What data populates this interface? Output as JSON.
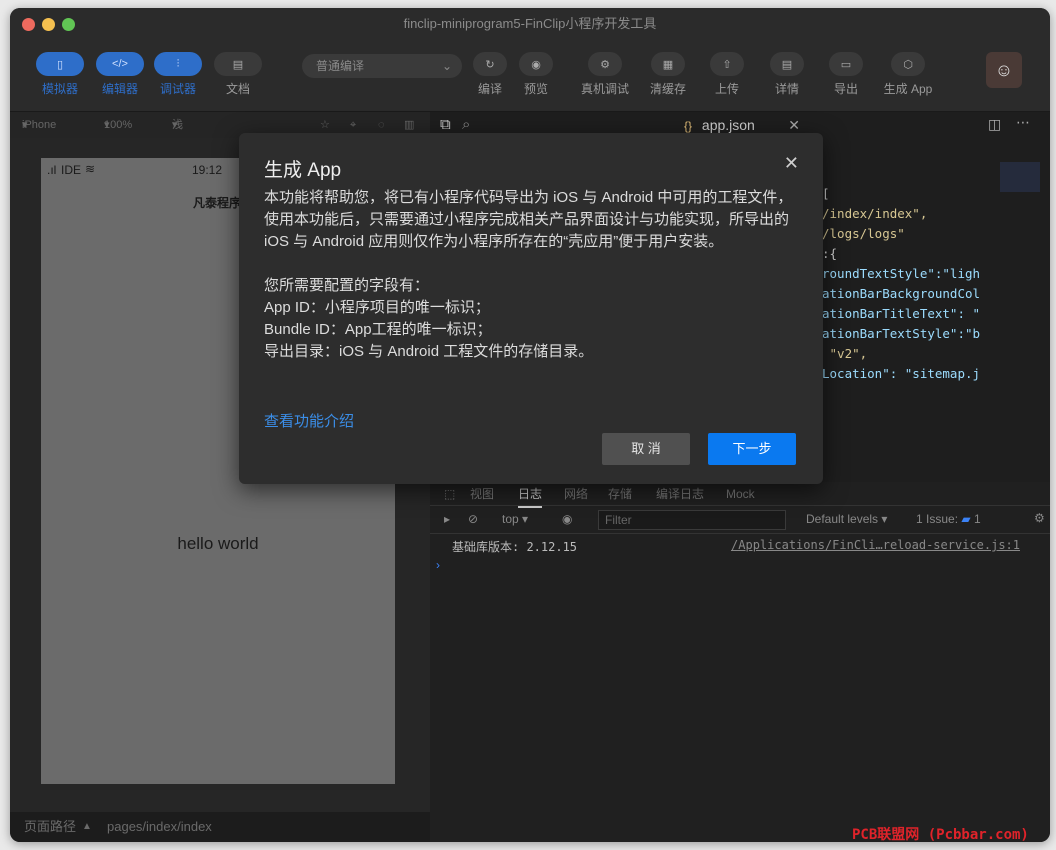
{
  "window": {
    "title": "finclip-miniprogram5-FinClip小程序开发工具"
  },
  "toolbar": {
    "simulator": "模拟器",
    "editor": "编辑器",
    "debugger": "调试器",
    "docs": "文档",
    "compile_mode": "普通编译",
    "compile": "编译",
    "preview": "预览",
    "device_debug": "真机调试",
    "clear_cache": "清缓存",
    "upload": "上传",
    "details": "详情",
    "export": "导出",
    "generate_app": "生成 App"
  },
  "subbar": {
    "device": "iPhone 5",
    "zoom": "100%",
    "theme": "浅色"
  },
  "phone": {
    "carrier": "IDE",
    "time": "19:12",
    "nav_title": "凡泰程序",
    "content": "hello world"
  },
  "path_bar": {
    "label": "页面路径",
    "path": "pages/index/index"
  },
  "editor": {
    "tab_icon": "{}",
    "tab_label": "app.json",
    "code_lines": [
      "[",
      "/index/index\",",
      "/logs/logs\"",
      "",
      ":{",
      "roundTextStyle\":\"ligh",
      "ationBarBackgroundCol",
      "ationBarTitleText\": \"",
      "ationBarTextStyle\":\"b",
      "",
      " \"v2\",",
      "Location\": \"sitemap.j"
    ]
  },
  "devtools": {
    "tabs": [
      "视图",
      "日志",
      "网络",
      "存储",
      "编译日志",
      "Mock"
    ],
    "context": "top",
    "filter_placeholder": "Filter",
    "levels": "Default levels",
    "issues": "1 Issue:",
    "issue_count": "1",
    "log_text": "基础库版本: 2.12.15",
    "log_source": "/Applications/FinCli…reload-service.js:1"
  },
  "dialog": {
    "title": "生成 App",
    "paragraph1": "本功能将帮助您，将已有小程序代码导出为 iOS 与 Android 中可用的工程文件，使用本功能后，只需要通过小程序完成相关产品界面设计与功能实现，所导出的 iOS 与 Android 应用则仅作为小程序所存在的“壳应用”便于用户安装。",
    "fields_intro": "您所需要配置的字段有：",
    "field_app_id": "App ID：小程序项目的唯一标识；",
    "field_bundle_id": "Bundle ID：App工程的唯一标识；",
    "field_export_dir": "导出目录：iOS 与 Android 工程文件的存储目录。",
    "link": "查看功能介绍",
    "cancel": "取 消",
    "next": "下一步"
  },
  "watermark": "PCB联盟网 (Pcbbar.com)",
  "colors": {
    "accent": "#0a79f0",
    "link": "#3b8ee8",
    "dialog_bg": "#2d2d2d"
  }
}
